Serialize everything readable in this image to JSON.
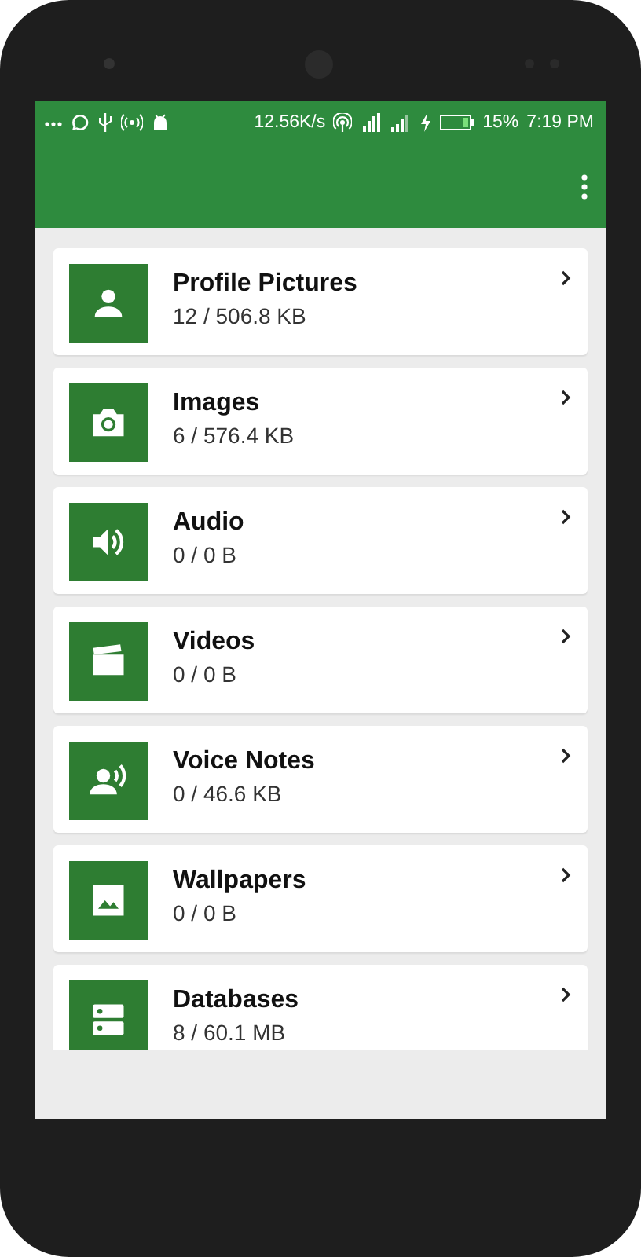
{
  "status_bar": {
    "speed": "12.56K/s",
    "battery": "15%",
    "time": "7:19 PM"
  },
  "folders": [
    {
      "title": "Profile Pictures",
      "subtitle": "12 / 506.8 KB"
    },
    {
      "title": "Images",
      "subtitle": "6 / 576.4 KB"
    },
    {
      "title": "Audio",
      "subtitle": "0 / 0 B"
    },
    {
      "title": "Videos",
      "subtitle": "0 / 0 B"
    },
    {
      "title": "Voice Notes",
      "subtitle": "0 / 46.6 KB"
    },
    {
      "title": "Wallpapers",
      "subtitle": "0 / 0 B"
    },
    {
      "title": "Databases",
      "subtitle": "8 / 60.1 MB"
    }
  ]
}
